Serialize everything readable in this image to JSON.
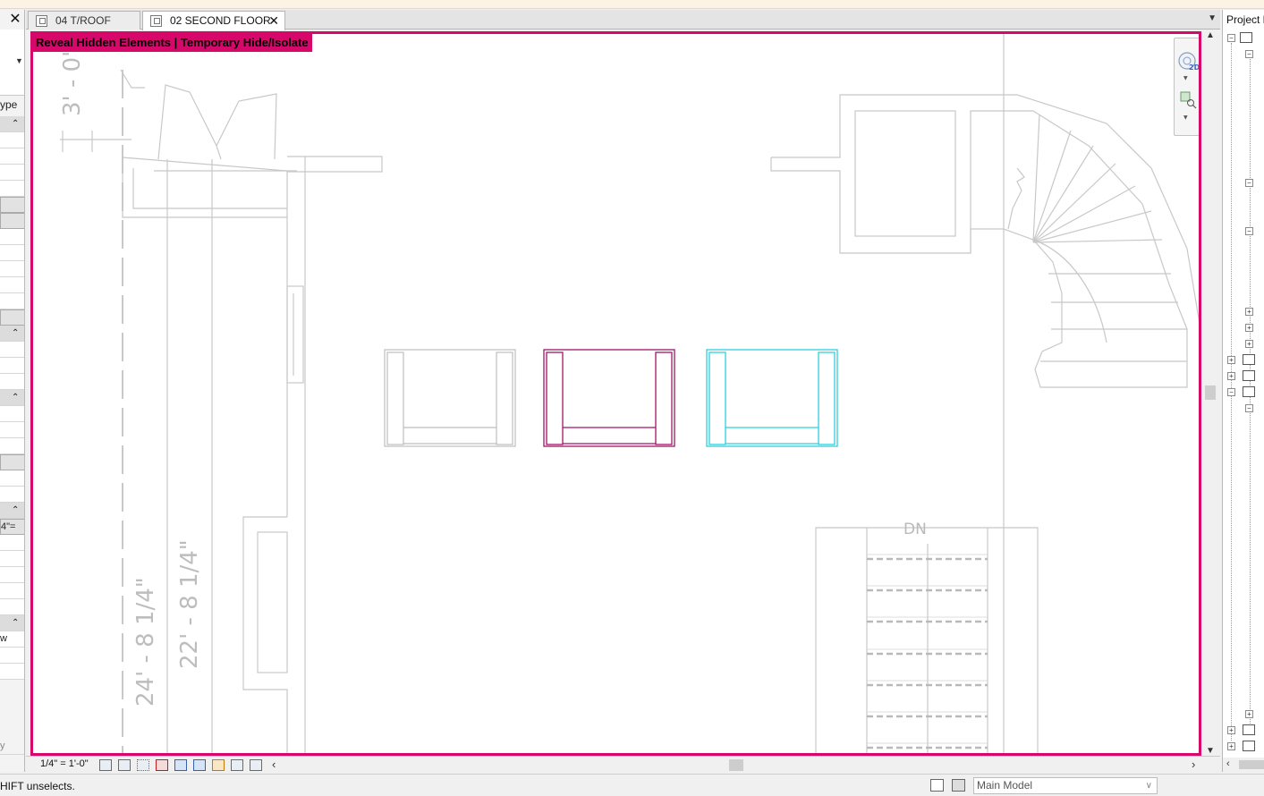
{
  "tabs": [
    {
      "label": "04 T/ROOF",
      "active": false
    },
    {
      "label": "02 SECOND FLOOR",
      "active": true
    }
  ],
  "left_panel": {
    "type_label": "ype",
    "scale_value": "4\"=",
    "row_w": "w",
    "row_y": "y"
  },
  "canvas": {
    "banner": "Reveal Hidden Elements | Temporary Hide/Isolate",
    "dimensions": {
      "top": "3' - 0\"",
      "left_long": "24' - 8 1/4\"",
      "left_short": "22' - 8 1/4\""
    },
    "stair_label": "DN",
    "highlight_color": "#d6096b",
    "selection_color": "#a01567",
    "active_color": "#2fd0dc"
  },
  "project_browser": {
    "title": "Project B"
  },
  "view_control_bar": {
    "scale": "1/4\" = 1'-0\""
  },
  "status_bar": {
    "message": "HIFT unselects.",
    "model": "Main Model"
  }
}
